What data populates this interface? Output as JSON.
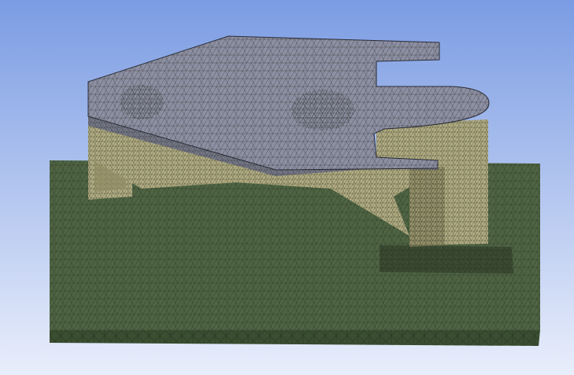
{
  "viewport": {
    "background_top": "#7b9ce3",
    "background_bottom": "#e9eefb"
  },
  "model": {
    "plate_color": "#8d8fa3",
    "plate_shadow_color": "#767889",
    "support_color": "#b3ae84",
    "support_dark_color": "#8e8a63",
    "ground_color": "#4e6443",
    "ground_edge_color": "#3a4e31",
    "mesh_line_color": "#1f2418"
  }
}
